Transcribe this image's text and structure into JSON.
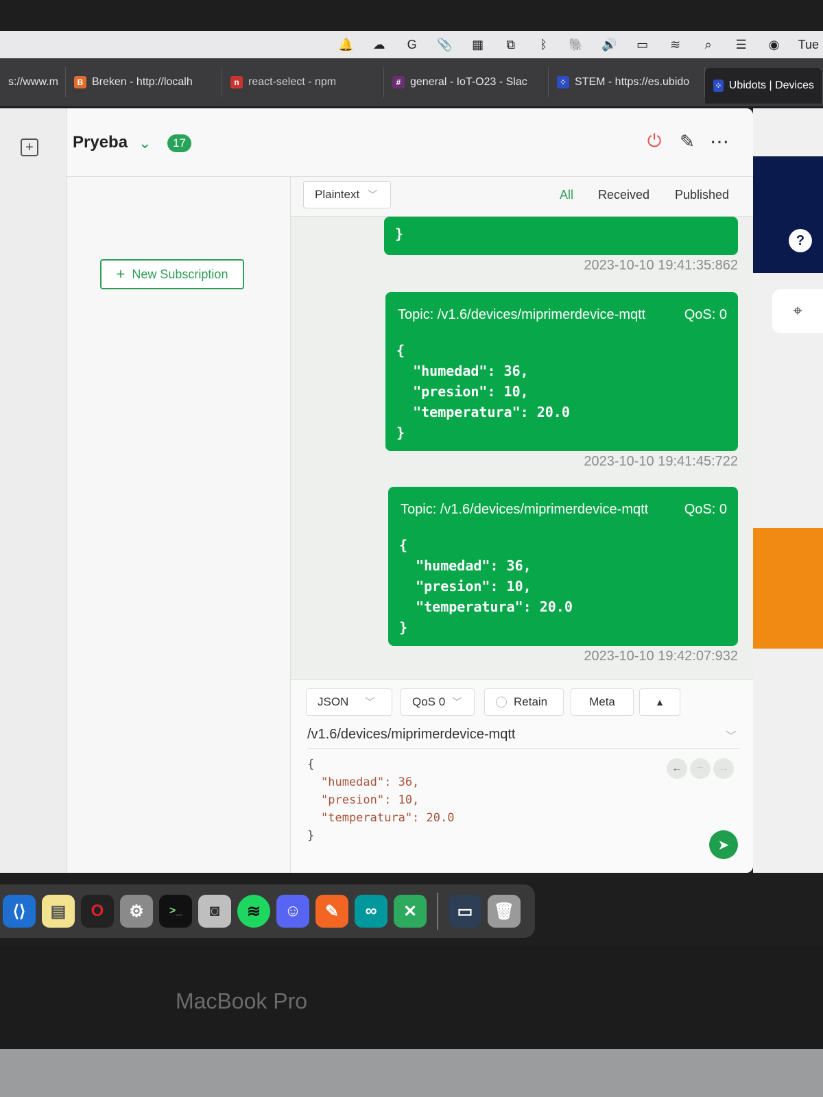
{
  "menubar": {
    "clock": "Tue",
    "icons": [
      "bell-icon",
      "cloud-icon",
      "grammarly-icon",
      "paperclip-icon",
      "clapper-icon",
      "screens-icon",
      "bluetooth-icon",
      "elephant-icon",
      "volume-icon",
      "battery-icon",
      "wifi-icon",
      "search-icon",
      "control-center-icon",
      "siri-icon"
    ]
  },
  "tabs": [
    {
      "label": "s://www.m"
    },
    {
      "label": "Breken - http://localh",
      "favicon": "B"
    },
    {
      "label": "react-select - npm",
      "favicon": "n"
    },
    {
      "label": "general - IoT-O23 - Slac",
      "favicon": "#"
    },
    {
      "label": "STEM - https://es.ubido",
      "favicon": "⁘"
    },
    {
      "label": "Ubidots | Devices",
      "favicon": "⁘"
    }
  ],
  "connection": {
    "name": "Pryeba",
    "badge": "17"
  },
  "subscriptions": {
    "new_label": "New Subscription"
  },
  "filter": {
    "format": "Plaintext",
    "tabs": [
      "All",
      "Received",
      "Published"
    ]
  },
  "messages": {
    "prev": {
      "closing": "}",
      "timestamp": "2023-10-10 19:41:35:862"
    },
    "items": [
      {
        "topic": "Topic: /v1.6/devices/miprimerdevice-mqtt",
        "qos": "QoS: 0",
        "payload": "{\n  \"humedad\": 36,\n  \"presion\": 10,\n  \"temperatura\": 20.0\n}",
        "timestamp": "2023-10-10 19:41:45:722"
      },
      {
        "topic": "Topic: /v1.6/devices/miprimerdevice-mqtt",
        "qos": "QoS: 0",
        "payload": "{\n  \"humedad\": 36,\n  \"presion\": 10,\n  \"temperatura\": 20.0\n}",
        "timestamp": "2023-10-10 19:42:07:932"
      }
    ]
  },
  "composer": {
    "format": "JSON",
    "qos": "QoS 0",
    "retain": "Retain",
    "meta": "Meta",
    "topic": "/v1.6/devices/miprimerdevice-mqtt",
    "payload_lines": [
      "{",
      "\"humedad\": 36,",
      "\"presion\": 10,",
      "\"temperatura\": 20.0",
      "}"
    ]
  },
  "dock": [
    "vscode-icon",
    "notes-icon",
    "opera-icon",
    "settings-icon",
    "terminal-icon",
    "screenshot-icon",
    "spotify-icon",
    "discord-icon",
    "pen-icon",
    "arduino-icon",
    "excel-icon",
    "window-icon",
    "trash-icon"
  ],
  "device_label": "MacBook Pro",
  "colors": {
    "accent": "#2f9e57",
    "bubble": "#08a74a"
  }
}
